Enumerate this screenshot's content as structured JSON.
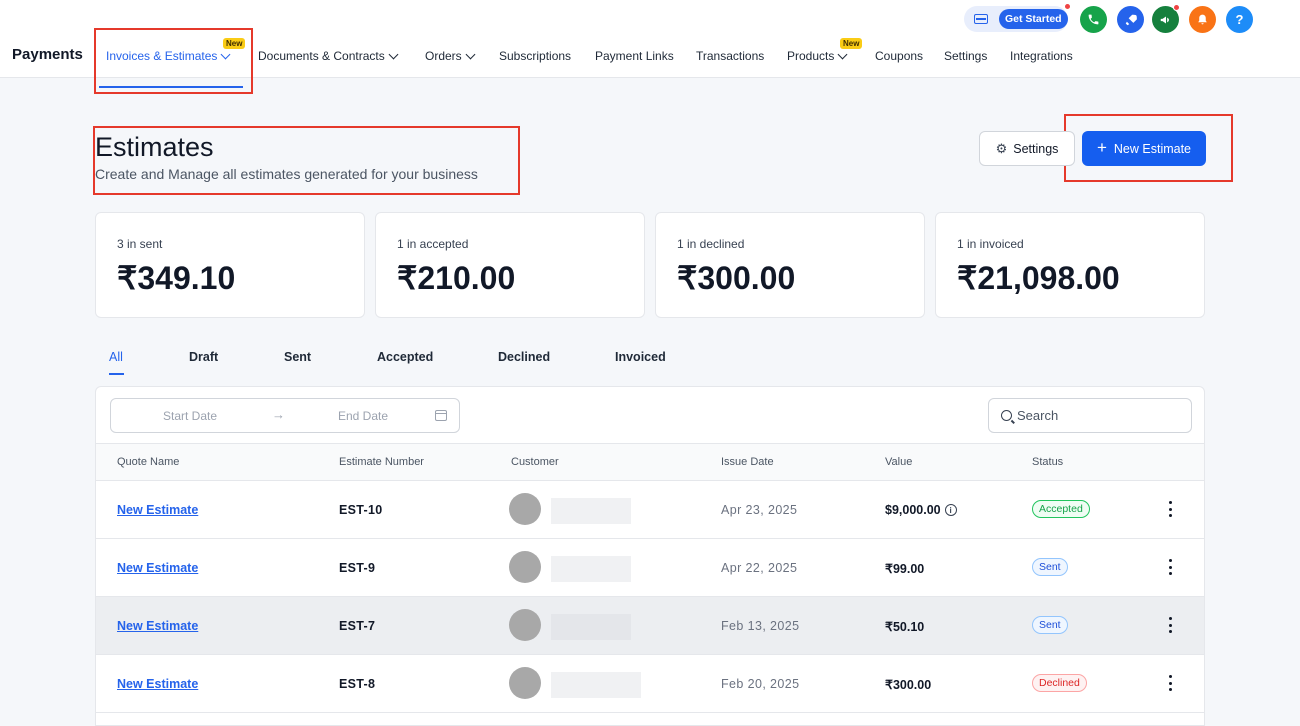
{
  "topbar": {
    "get_started_label": "Get Started",
    "icons": [
      "card-icon",
      "phone-icon",
      "rocket-icon",
      "megaphone-icon",
      "bell-icon",
      "help-icon"
    ],
    "help_glyph": "?"
  },
  "nav": {
    "app_title": "Payments",
    "new_badge": "New",
    "items": [
      {
        "label": "Invoices & Estimates",
        "active": true,
        "dropdown": true,
        "badge": "New"
      },
      {
        "label": "Documents & Contracts",
        "dropdown": true
      },
      {
        "label": "Orders",
        "dropdown": true
      },
      {
        "label": "Subscriptions"
      },
      {
        "label": "Payment Links"
      },
      {
        "label": "Transactions"
      },
      {
        "label": "Products",
        "dropdown": true,
        "badge": "New"
      },
      {
        "label": "Coupons"
      },
      {
        "label": "Settings"
      },
      {
        "label": "Integrations"
      }
    ]
  },
  "header": {
    "title": "Estimates",
    "subtitle": "Create and Manage all estimates generated for your business",
    "settings_label": "Settings",
    "new_estimate_label": "New Estimate"
  },
  "stats": [
    {
      "label": "3 in sent",
      "value": "₹349.10"
    },
    {
      "label": "1 in accepted",
      "value": "₹210.00"
    },
    {
      "label": "1 in declined",
      "value": "₹300.00"
    },
    {
      "label": "1 in invoiced",
      "value": "₹21,098.00"
    }
  ],
  "tabs": [
    {
      "label": "All",
      "active": true
    },
    {
      "label": "Draft"
    },
    {
      "label": "Sent"
    },
    {
      "label": "Accepted"
    },
    {
      "label": "Declined"
    },
    {
      "label": "Invoiced"
    }
  ],
  "filters": {
    "start_date_placeholder": "Start Date",
    "end_date_placeholder": "End Date",
    "arrow": "→",
    "search_placeholder": "Search"
  },
  "table": {
    "columns": [
      "Quote Name",
      "Estimate Number",
      "Customer",
      "Issue Date",
      "Value",
      "Status"
    ],
    "rows": [
      {
        "quote_name": "New Estimate",
        "number": "EST-10",
        "issue_date": "Apr 23, 2025",
        "value": "$9,000.00",
        "info": "i",
        "status": "Accepted",
        "status_kind": "accepted"
      },
      {
        "quote_name": "New Estimate",
        "number": "EST-9",
        "issue_date": "Apr 22, 2025",
        "value": "₹99.00",
        "status": "Sent",
        "status_kind": "sent"
      },
      {
        "quote_name": "New Estimate",
        "number": "EST-7",
        "issue_date": "Feb 13, 2025",
        "value": "₹50.10",
        "status": "Sent",
        "status_kind": "sent"
      },
      {
        "quote_name": "New Estimate",
        "number": "EST-8",
        "issue_date": "Feb 20, 2025",
        "value": "₹300.00",
        "status": "Declined",
        "status_kind": "declined"
      }
    ]
  },
  "colors": {
    "accent": "#155eef",
    "annotation": "#e5392b",
    "phone": "#16a34a",
    "rocket": "#2563eb",
    "megaphone": "#15803d",
    "bell": "#f97316",
    "help": "#1d8cf8"
  }
}
